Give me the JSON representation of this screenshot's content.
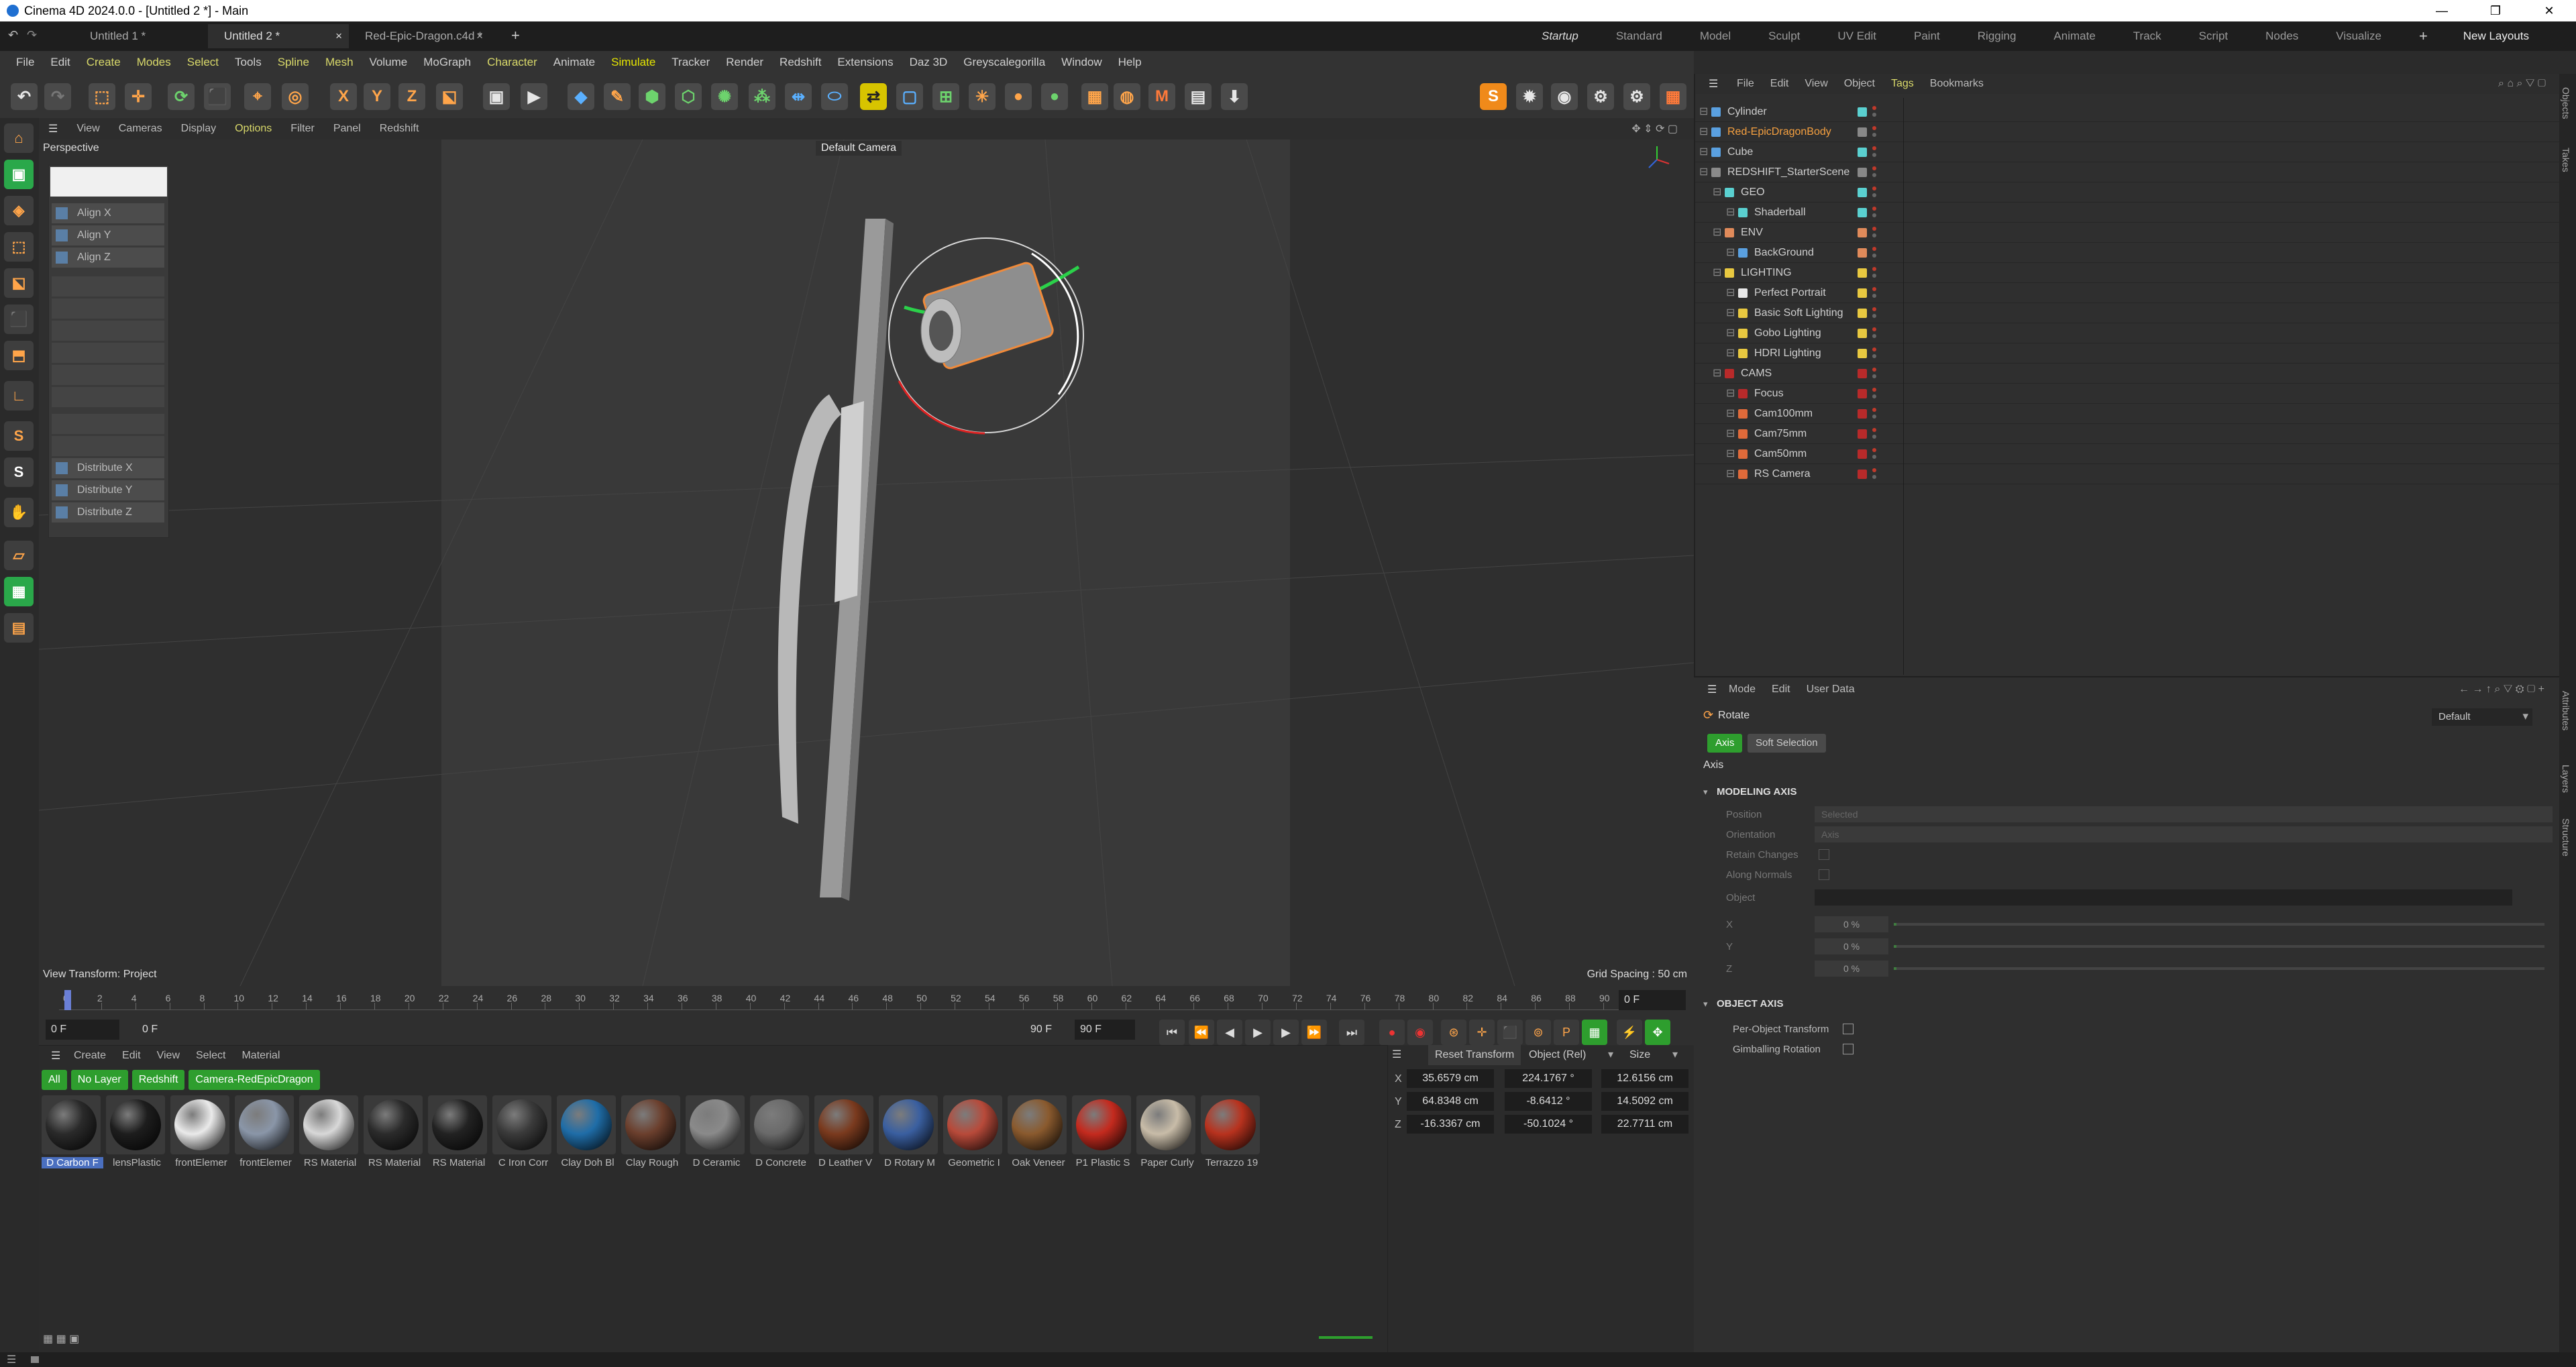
{
  "window": {
    "title": "Cinema 4D 2024.0.0 - [Untitled 2 *] - Main",
    "controls": [
      "—",
      "❐",
      "✕"
    ]
  },
  "doc_tabs": [
    {
      "label": "Untitled 1 *"
    },
    {
      "label": "Untitled 2 *"
    },
    {
      "label": "Red-Epic-Dragon.c4d *"
    }
  ],
  "layouts": [
    "Startup",
    "Standard",
    "Model",
    "Sculpt",
    "UV Edit",
    "Paint",
    "Rigging",
    "Animate",
    "Track",
    "Script",
    "Nodes",
    "Visualize"
  ],
  "new_layouts": "New Layouts",
  "menubar": [
    "File",
    "Edit",
    "Create",
    "Modes",
    "Select",
    "Tools",
    "Spline",
    "Mesh",
    "Volume",
    "MoGraph",
    "Character",
    "Animate",
    "Simulate",
    "Tracker",
    "Render",
    "Redshift",
    "Extensions",
    "Daz 3D",
    "Greyscalegorilla",
    "Window",
    "Help"
  ],
  "viewport_menu": [
    "View",
    "Cameras",
    "Display",
    "Options",
    "Filter",
    "Panel",
    "Redshift"
  ],
  "viewport": {
    "projection": "Perspective",
    "camera": "Default Camera",
    "view_transform": "View Transform: Project",
    "grid_spacing": "Grid Spacing : 50 cm"
  },
  "align_panel": {
    "buttons": [
      "Align X",
      "Align Y",
      "Align Z",
      "Distribute X",
      "Distribute Y",
      "Distribute Z"
    ]
  },
  "timeline": {
    "ticks": [
      "0",
      "2",
      "4",
      "6",
      "8",
      "10",
      "12",
      "14",
      "16",
      "18",
      "20",
      "22",
      "24",
      "26",
      "28",
      "30",
      "32",
      "34",
      "36",
      "38",
      "40",
      "42",
      "44",
      "46",
      "48",
      "50",
      "52",
      "54",
      "56",
      "58",
      "60",
      "62",
      "64",
      "66",
      "68",
      "70",
      "72",
      "74",
      "76",
      "78",
      "80",
      "82",
      "84",
      "86",
      "88",
      "90"
    ],
    "current_frame": "0 F",
    "start_frame": "0 F",
    "start_frame2": "0 F",
    "end_frame": "90 F",
    "end_frame2": "90 F"
  },
  "material_menu": [
    "Create",
    "Edit",
    "View",
    "Select",
    "Material"
  ],
  "material_filters": [
    "All",
    "No Layer",
    "Redshift",
    "Camera-RedEpicDragon"
  ],
  "materials": [
    {
      "name": "D Carbon F",
      "color": "#2a2a2a"
    },
    {
      "name": "lensPlastic",
      "color": "#1d1d1d"
    },
    {
      "name": "frontElemer",
      "color": "#eaeaea"
    },
    {
      "name": "frontElemer",
      "color": "#8a96a8"
    },
    {
      "name": "RS Material",
      "color": "#d8d8d8"
    },
    {
      "name": "RS Material",
      "color": "#2b2b2b"
    },
    {
      "name": "RS Material",
      "color": "#222222"
    },
    {
      "name": "C Iron Corr",
      "color": "#3a3a3a"
    },
    {
      "name": "Clay Doh Bl",
      "color": "#1f6da8"
    },
    {
      "name": "Clay Rough",
      "color": "#6b3f2d"
    },
    {
      "name": "D Ceramic",
      "color": "#8a8a8a"
    },
    {
      "name": "D Concrete",
      "color": "#6a6a6a"
    },
    {
      "name": "D Leather V",
      "color": "#7a3a1e"
    },
    {
      "name": "D Rotary M",
      "color": "#3a5fa0"
    },
    {
      "name": "Geometric I",
      "color": "#b84a3a"
    },
    {
      "name": "Oak Veneer",
      "color": "#8a5a2e"
    },
    {
      "name": "P1 Plastic S",
      "color": "#c42a1e"
    },
    {
      "name": "Paper Curly",
      "color": "#c8bca8"
    },
    {
      "name": "Terrazzo 19",
      "color": "#b8321e"
    }
  ],
  "coords": {
    "reset_label": "Reset Transform",
    "mode": "Object (Rel)",
    "size_mode": "Size",
    "rows": [
      {
        "axis": "X",
        "pos": "35.6579 cm",
        "rot": "224.1767 °",
        "size": "12.6156 cm"
      },
      {
        "axis": "Y",
        "pos": "64.8348 cm",
        "rot": "-8.6412 °",
        "size": "14.5092 cm"
      },
      {
        "axis": "Z",
        "pos": "-16.3367 cm",
        "rot": "-50.1024 °",
        "size": "22.7711 cm"
      }
    ]
  },
  "object_manager": {
    "menu": [
      "File",
      "Edit",
      "View",
      "Object",
      "Tags",
      "Bookmarks"
    ],
    "rows": [
      {
        "name": "Cylinder",
        "indent": 0,
        "icon": "#5aa0e0",
        "layer": "#5ad0d0",
        "orange": false
      },
      {
        "name": "Red-EpicDragonBody",
        "indent": 0,
        "icon": "#5aa0e0",
        "layer": "#888888",
        "orange": true
      },
      {
        "name": "Cube",
        "indent": 0,
        "icon": "#5aa0e0",
        "layer": "#5ad0d0",
        "orange": false
      },
      {
        "name": "REDSHIFT_StarterScene",
        "indent": 0,
        "icon": "#8a8a8a",
        "layer": "#888888",
        "orange": false
      },
      {
        "name": "GEO",
        "indent": 1,
        "icon": "#5ad0d0",
        "layer": "#5ad0d0",
        "orange": false
      },
      {
        "name": "Shaderball",
        "indent": 2,
        "icon": "#5ad0d0",
        "layer": "#5ad0d0",
        "orange": false
      },
      {
        "name": "ENV",
        "indent": 1,
        "icon": "#e08a5a",
        "layer": "#e08a5a",
        "orange": false
      },
      {
        "name": "BackGround",
        "indent": 2,
        "icon": "#5aa0e0",
        "layer": "#e08a5a",
        "orange": false
      },
      {
        "name": "LIGHTING",
        "indent": 1,
        "icon": "#e8c840",
        "layer": "#e8c840",
        "orange": false
      },
      {
        "name": "Perfect Portrait",
        "indent": 2,
        "icon": "#e8e8e8",
        "layer": "#e8c840",
        "orange": false
      },
      {
        "name": "Basic Soft Lighting",
        "indent": 2,
        "icon": "#e8c840",
        "layer": "#e8c840",
        "orange": false
      },
      {
        "name": "Gobo Lighting",
        "indent": 2,
        "icon": "#e8c840",
        "layer": "#e8c840",
        "orange": false
      },
      {
        "name": "HDRI Lighting",
        "indent": 2,
        "icon": "#e8c840",
        "layer": "#e8c840",
        "orange": false
      },
      {
        "name": "CAMS",
        "indent": 1,
        "icon": "#b82a2a",
        "layer": "#b82a2a",
        "orange": false
      },
      {
        "name": "Focus",
        "indent": 2,
        "icon": "#b82a2a",
        "layer": "#b82a2a",
        "orange": false
      },
      {
        "name": "Cam100mm",
        "indent": 2,
        "icon": "#e06a3a",
        "layer": "#b82a2a",
        "orange": false
      },
      {
        "name": "Cam75mm",
        "indent": 2,
        "icon": "#e06a3a",
        "layer": "#b82a2a",
        "orange": false
      },
      {
        "name": "Cam50mm",
        "indent": 2,
        "icon": "#e06a3a",
        "layer": "#b82a2a",
        "orange": false
      },
      {
        "name": "RS Camera",
        "indent": 2,
        "icon": "#e06a3a",
        "layer": "#b82a2a",
        "orange": false
      }
    ]
  },
  "attributes": {
    "menu": [
      "Mode",
      "Edit",
      "User Data"
    ],
    "tool": "Rotate",
    "preset": "Default",
    "tabs": [
      "Axis",
      "Soft Selection"
    ],
    "heading": "Axis",
    "modeling_axis": "MODELING AXIS",
    "fields": [
      {
        "label": "Position",
        "value": "Selected"
      },
      {
        "label": "Orientation",
        "value": "Axis"
      },
      {
        "label": "Retain Changes",
        "value": ""
      },
      {
        "label": "Along Normals",
        "value": ""
      },
      {
        "label": "Object",
        "value": ""
      }
    ],
    "xyz": [
      {
        "label": "X",
        "value": "0 %",
        "level": 0
      },
      {
        "label": "Y",
        "value": "0 %",
        "level": 0
      },
      {
        "label": "Z",
        "value": "0 %",
        "level": 0
      }
    ],
    "object_axis": "OBJECT AXIS",
    "per_object": "Per-Object Transform",
    "gimballing": "Gimballing Rotation"
  },
  "side_tabs": [
    "Objects",
    "Takes",
    "Attributes",
    "Layers",
    "Structure"
  ]
}
